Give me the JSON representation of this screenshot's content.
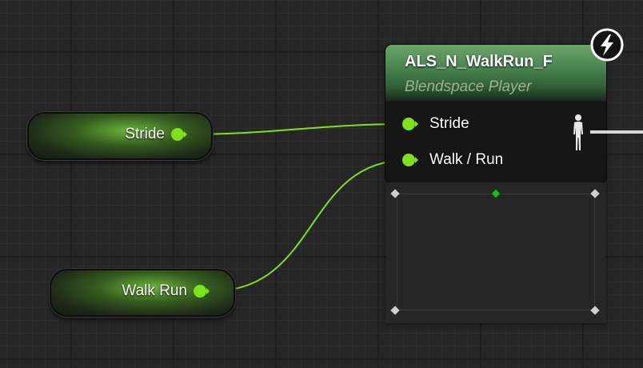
{
  "variables": [
    {
      "id": "stride",
      "label": "Stride"
    },
    {
      "id": "walk_run",
      "label": "Walk Run"
    }
  ],
  "blendspace_node": {
    "title": "ALS_N_WalkRun_F",
    "subtitle": "Blendspace Player",
    "inputs": [
      "Stride",
      "Walk / Run"
    ]
  },
  "colors": {
    "pin_float": "#7de21a",
    "wire": "#7de21a",
    "header_green": "#4b8650",
    "output_pose": "#d8d8d8",
    "sample_point": "#d0d0d0",
    "sample_point_active": "#19c219"
  },
  "icons": {
    "event_badge": "lightning-bolt-icon",
    "pose_output": "mannequin-icon"
  }
}
